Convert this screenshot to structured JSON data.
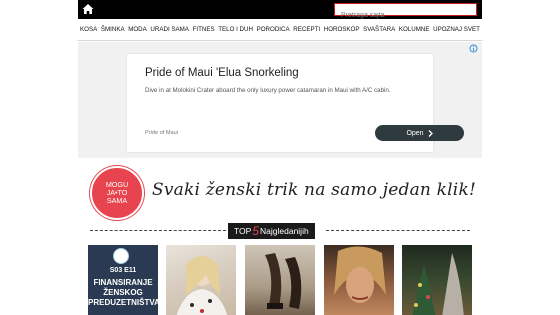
{
  "header": {
    "search_placeholder": "Pretraga sajta",
    "home_icon": "home-icon"
  },
  "nav": {
    "items": [
      "KOSA",
      "ŠMINKA",
      "MODA",
      "URADI SAMA",
      "FITNES",
      "TELO I DUH",
      "PORODICA",
      "RECEPTI",
      "HOROSKOP",
      "SVAŠTARA",
      "KOLUMNE",
      "UPOZNAJ SVET"
    ]
  },
  "ad": {
    "title": "Pride of Maui 'Elua Snorkeling",
    "description": "Dive in at Molokini Crater aboard the only luxury power catamaran in Maui with A/C cabin.",
    "brand": "Pride of Maui",
    "button_label": "Open",
    "adchoices_icon": "adchoices-icon"
  },
  "brand": {
    "logo_lines": [
      "MOGU",
      "JA•TO",
      "SAMA"
    ],
    "tagline": "Svaki ženski trik na samo jedan klik!"
  },
  "top5": {
    "prefix": "TOP",
    "number": "5",
    "suffix": "Najgledanijih"
  },
  "thumbnails": {
    "first": {
      "episode": "S03 E11",
      "title_lines": [
        "FINANSIRANJE",
        "ŽENSKOG",
        "PREDUZETNIŠTVA"
      ]
    }
  },
  "colors": {
    "accent": "#e8444f",
    "topbar": "#000000",
    "ad_button": "#2f3a3f"
  }
}
